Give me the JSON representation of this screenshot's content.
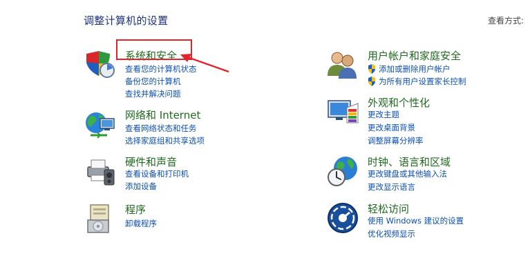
{
  "page_title": "调整计算机的设置",
  "view_by_label": "查看方式:",
  "colors": {
    "title": "#1e6a1e",
    "link": "#0d4fb3",
    "heading": "#1e3287",
    "annotation": "#e0242a"
  },
  "categories": [
    {
      "title": "系统和安全",
      "icon": "shield-icon",
      "links": [
        "查看您的计算机状态",
        "备份您的计算机",
        "查找并解决问题"
      ]
    },
    {
      "title": "网络和 Internet",
      "icon": "network-globe-icon",
      "links": [
        "查看网络状态和任务",
        "选择家庭组和共享选项"
      ]
    },
    {
      "title": "硬件和声音",
      "icon": "printer-icon",
      "links": [
        "查看设备和打印机",
        "添加设备"
      ]
    },
    {
      "title": "程序",
      "icon": "programs-icon",
      "links": [
        "卸载程序"
      ]
    },
    {
      "title": "用户帐户和家庭安全",
      "icon": "users-icon",
      "links": [
        "添加或删除用户帐户",
        "为所有用户设置家长控制"
      ]
    },
    {
      "title": "外观和个性化",
      "icon": "monitor-palette-icon",
      "links": [
        "更改主题",
        "更改桌面背景",
        "调整屏幕分辨率"
      ]
    },
    {
      "title": "时钟、语言和区域",
      "icon": "clock-globe-icon",
      "links": [
        "更改键盘或其他输入法",
        "更改显示语言"
      ]
    },
    {
      "title": "轻松访问",
      "icon": "ease-of-access-icon",
      "links": [
        "使用 Windows 建议的设置",
        "优化视频显示"
      ]
    }
  ]
}
